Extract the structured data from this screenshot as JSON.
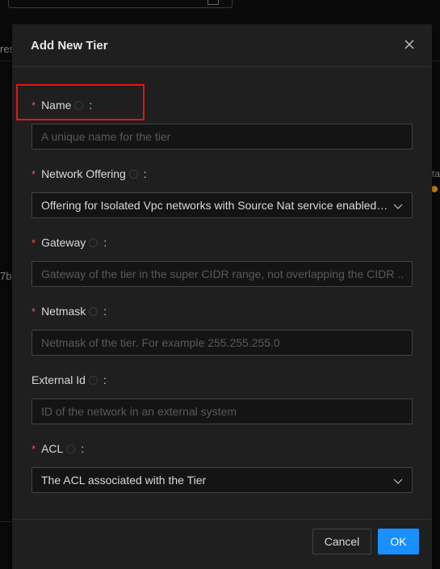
{
  "background": {
    "left_fragment_1": "res",
    "left_fragment_2": "7b",
    "right_fragment": "ta"
  },
  "modal": {
    "title": "Add New Tier",
    "fields": [
      {
        "label": "Name",
        "required": true,
        "type": "input",
        "value": "",
        "placeholder": "A unique name for the tier"
      },
      {
        "label": "Network Offering",
        "required": true,
        "type": "select",
        "value": "Offering for Isolated Vpc networks with Source Nat service enabled a..."
      },
      {
        "label": "Gateway",
        "required": true,
        "type": "input",
        "value": "",
        "placeholder": "Gateway of the tier in the super CIDR range, not overlapping the CIDR ..."
      },
      {
        "label": "Netmask",
        "required": true,
        "type": "input",
        "value": "",
        "placeholder": "Netmask of the tier. For example 255.255.255.0"
      },
      {
        "label": "External Id",
        "required": false,
        "type": "input",
        "value": "",
        "placeholder": "ID of the network in an external system"
      },
      {
        "label": "ACL",
        "required": true,
        "type": "select",
        "value": "The ACL associated with the Tier"
      }
    ],
    "required_mark": "*",
    "colon": ":",
    "footer": {
      "cancel_label": "Cancel",
      "ok_label": "OK"
    }
  },
  "colors": {
    "accent": "#1890ff",
    "required": "#ff4d4f",
    "highlight_box": "#e01616"
  },
  "icons": {
    "close": "close-icon",
    "info": "info-icon",
    "dropdown": "chevron-down-icon"
  }
}
